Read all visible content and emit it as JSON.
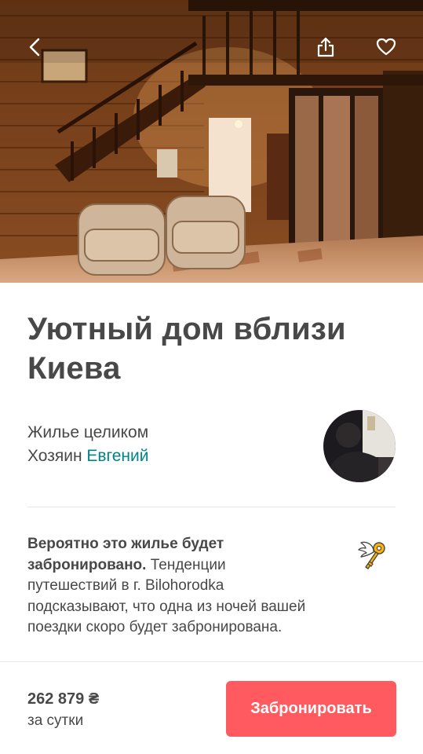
{
  "header": {
    "back_icon": "chevron-left-icon",
    "share_icon": "share-icon",
    "favorite_icon": "heart-icon"
  },
  "listing": {
    "title": "Уютный дом вблизи Киева",
    "home_type": "Жилье целиком",
    "host_prefix": "Хозяин",
    "host_name": "Евгений"
  },
  "notice": {
    "bold": "Вероятно это жилье будет забронировано.",
    "text": "Тенденции путешествий в г. Bilohorodka подсказывают, что одна из ночей вашей поездки скоро будет забронирована.",
    "icon": "winged-key-icon"
  },
  "footer": {
    "price": "262 879 ₴",
    "per": "за сутки",
    "book_label": "Забронировать"
  },
  "colors": {
    "accent": "#ff5a5f",
    "link": "#008489",
    "text": "#484848"
  }
}
